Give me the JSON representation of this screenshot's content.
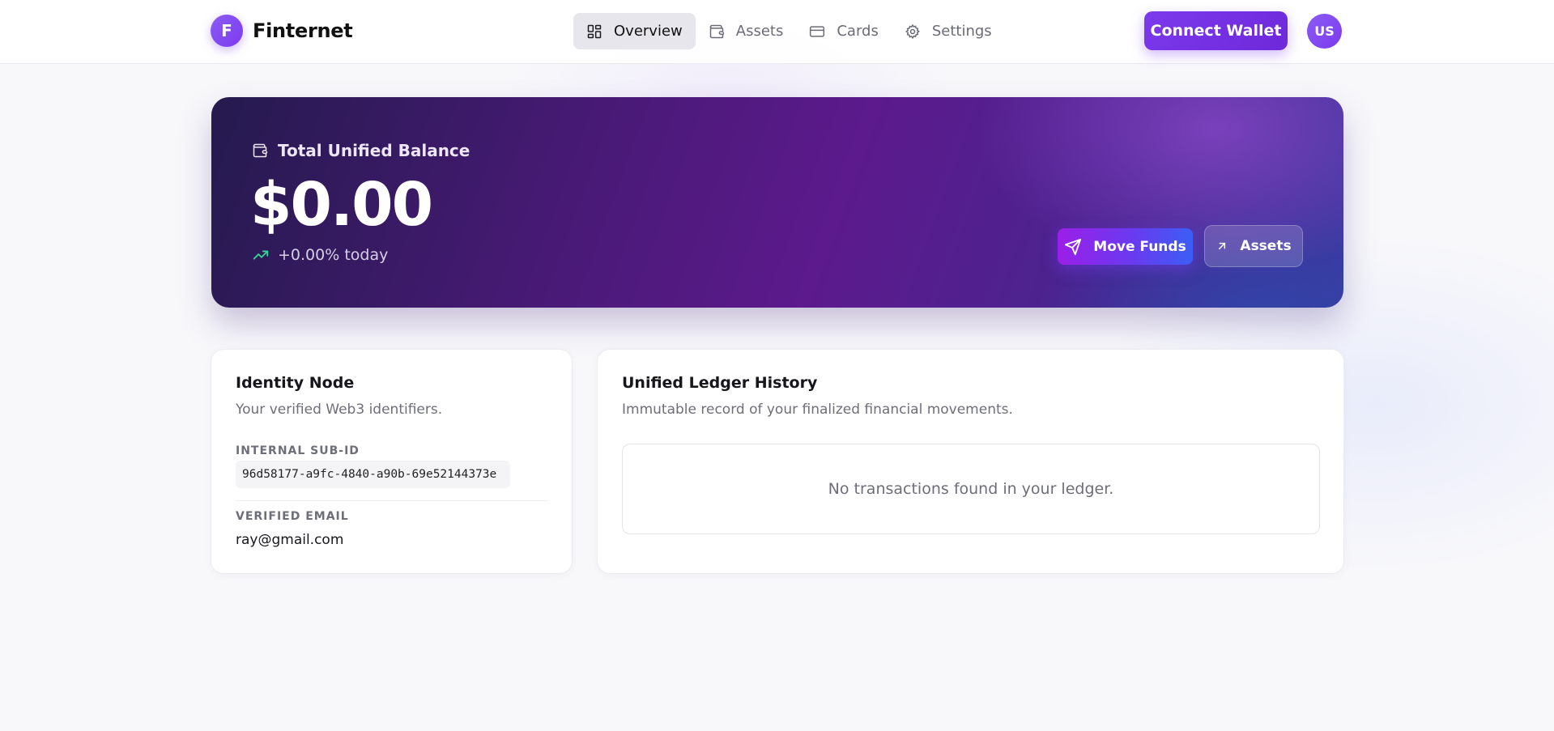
{
  "brand": {
    "logo_letter": "F",
    "name": "Finternet"
  },
  "nav": {
    "items": [
      {
        "label": "Overview",
        "icon": "grid-icon",
        "active": true
      },
      {
        "label": "Assets",
        "icon": "wallet-icon",
        "active": false
      },
      {
        "label": "Cards",
        "icon": "credit-card-icon",
        "active": false
      },
      {
        "label": "Settings",
        "icon": "gear-icon",
        "active": false
      }
    ]
  },
  "header": {
    "connect_label": "Connect Wallet",
    "avatar_initials": "US"
  },
  "balance": {
    "label": "Total Unified Balance",
    "amount": "$0.00",
    "change": "+0.00% today",
    "move_label": "Move Funds",
    "assets_label": "Assets"
  },
  "identity": {
    "title": "Identity Node",
    "subtitle": "Your verified Web3 identifiers.",
    "sub_id_label": "Internal Sub-ID",
    "sub_id_value": "96d58177-a9fc-4840-a90b-69e52144373e",
    "email_label": "Verified Email",
    "email_value": "ray@gmail.com"
  },
  "ledger": {
    "title": "Unified Ledger History",
    "subtitle": "Immutable record of your finalized financial movements.",
    "empty_message": "No transactions found in your ledger."
  },
  "colors": {
    "accent": "#7c3aed",
    "trend_up": "#34d399",
    "background": "#f8f8fb"
  }
}
